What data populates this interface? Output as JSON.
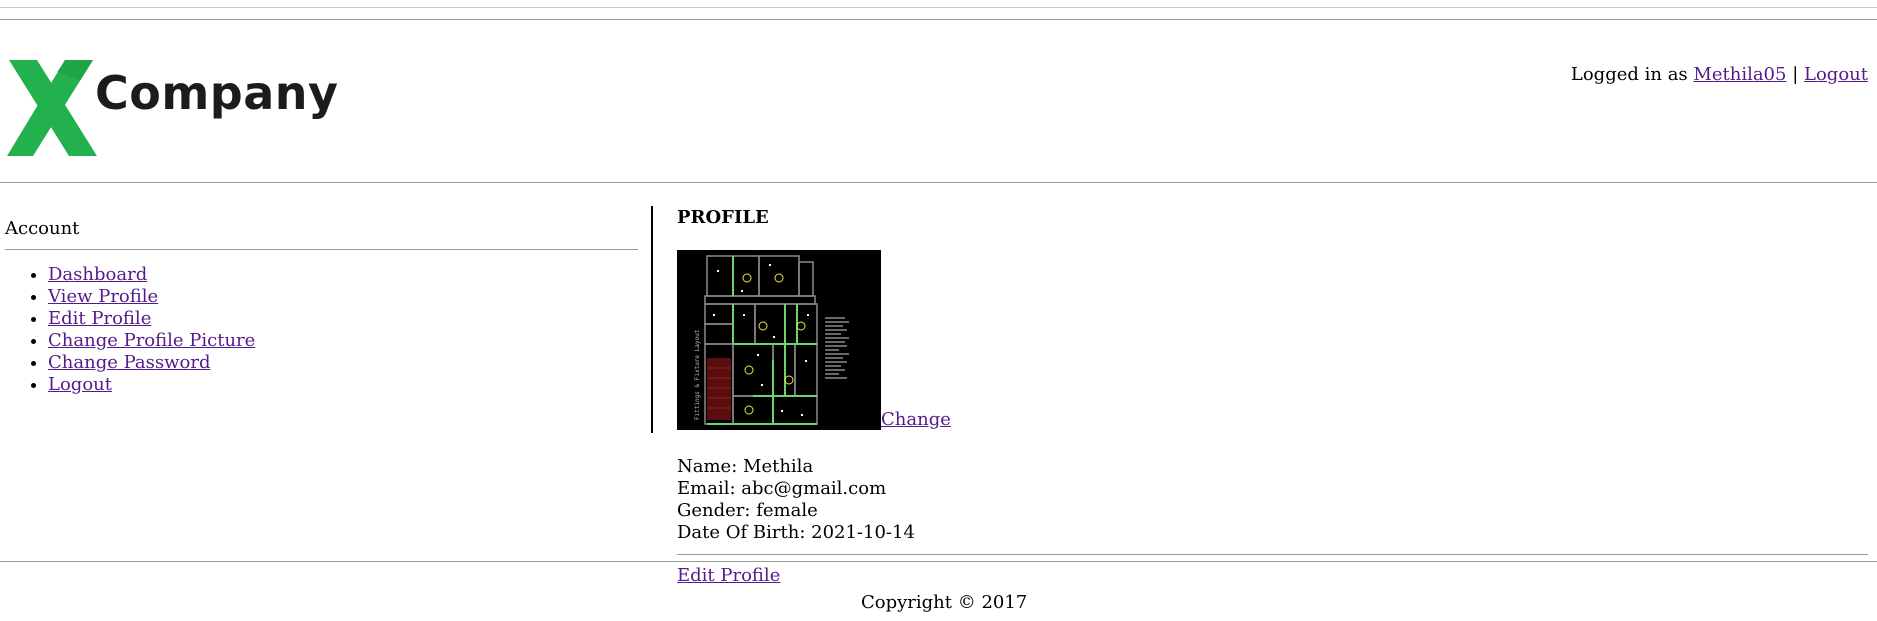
{
  "header": {
    "logo": {
      "letter": "X",
      "text": "Company",
      "accent": "#23b14d"
    },
    "login": {
      "prefix": "Logged in as",
      "username": "Methila05",
      "separator": "|",
      "logout": "Logout"
    }
  },
  "sidebar": {
    "title": "Account",
    "items": [
      {
        "label": "Dashboard"
      },
      {
        "label": "View Profile"
      },
      {
        "label": "Edit Profile"
      },
      {
        "label": "Change Profile Picture"
      },
      {
        "label": "Change Password"
      },
      {
        "label": "Logout"
      }
    ]
  },
  "profile": {
    "title": "PROFILE",
    "picture_label": "Fittings & Fixture Layout",
    "change_label": "Change",
    "fields": [
      {
        "label": "Name:",
        "value": "Methila"
      },
      {
        "label": "Email:",
        "value": "abc@gmail.com"
      },
      {
        "label": "Gender:",
        "value": "female"
      },
      {
        "label": "Date Of Birth:",
        "value": "2021-10-14"
      }
    ],
    "edit_label": "Edit Profile"
  },
  "footer": {
    "copyright": "Copyright © 2017"
  },
  "colors": {
    "link": "#551a8b",
    "rule": "#9a9a9a",
    "logo_green": "#23b14d",
    "floorplan_bg": "#000000",
    "floorplan_wall": "#6fd16f"
  }
}
